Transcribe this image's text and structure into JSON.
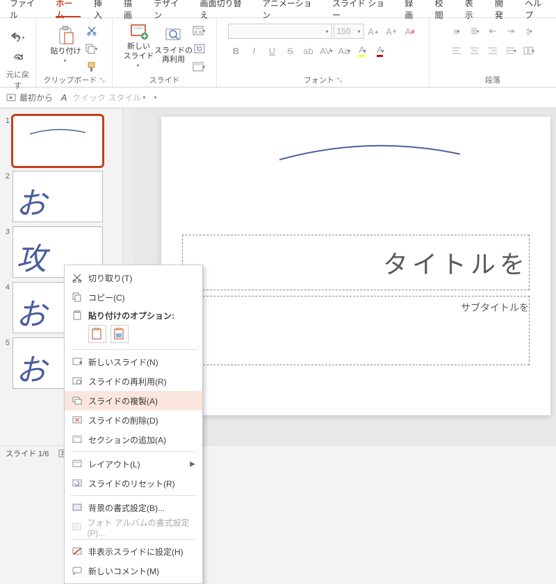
{
  "menu": {
    "tabs": [
      "ファイル",
      "ホーム",
      "挿入",
      "描画",
      "デザイン",
      "画面切り替え",
      "アニメーション",
      "スライド ショー",
      "録画",
      "校閲",
      "表示",
      "開発",
      "ヘルプ"
    ],
    "active_index": 1
  },
  "ribbon": {
    "undo_group": "元に戻す",
    "clipboard": {
      "paste": "貼り付け",
      "label": "クリップボード"
    },
    "slides": {
      "new": "新しい\nスライド",
      "reuse": "スライドの\n再利用",
      "label": "スライド"
    },
    "font": {
      "size": "150",
      "label": "フォント"
    },
    "paragraph": {
      "label": "段落"
    }
  },
  "toolbar2": {
    "from_start": "最初から",
    "quick_style": "クイック スタイル"
  },
  "slides": [
    {
      "num": "1"
    },
    {
      "num": "2"
    },
    {
      "num": "3"
    },
    {
      "num": "4"
    },
    {
      "num": "5"
    }
  ],
  "canvas": {
    "title_placeholder": "タイトルを",
    "subtitle_placeholder": "サブタイトルを"
  },
  "context_menu": {
    "cut": "切り取り(T)",
    "copy": "コピー(C)",
    "paste_options": "貼り付けのオプション:",
    "new_slide": "新しいスライド(N)",
    "reuse_slide": "スライドの再利用(R)",
    "duplicate": "スライドの複製(A)",
    "delete": "スライドの削除(D)",
    "add_section": "セクションの追加(A)",
    "layout": "レイアウト(L)",
    "reset": "スライドのリセット(R)",
    "background": "背景の書式設定(B)...",
    "photo_album": "フォト アルバムの書式設定(P)...",
    "hide_slide": "非表示スライドに設定(H)",
    "new_comment": "新しいコメント(M)"
  },
  "status": {
    "slide": "スライド 1/6"
  }
}
